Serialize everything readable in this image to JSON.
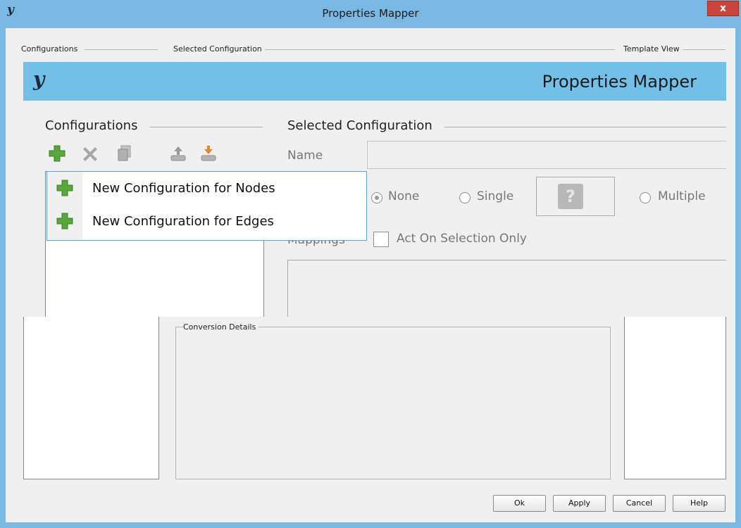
{
  "window": {
    "title": "Properties Mapper",
    "logo": "y",
    "close_label": "x"
  },
  "outer": {
    "configurations_label": "Configurations",
    "selected_configuration_label": "Selected Configuration",
    "template_view_label": "Template View",
    "conversion_details_label": "Conversion Details",
    "buttons": {
      "ok": "Ok",
      "apply": "Apply",
      "cancel": "Cancel",
      "help": "Help"
    }
  },
  "zoom": {
    "logo": "y",
    "title": "Properties Mapper",
    "configurations_label": "Configurations",
    "selected_configuration_label": "Selected Configuration",
    "name_label": "Name",
    "name_value": "",
    "radio_none": "None",
    "radio_single": "Single",
    "radio_multiple": "Multiple",
    "help_glyph": "?",
    "mappings_label": "Mappings",
    "act_on_selection_label": "Act On Selection Only",
    "toolbar_icons": [
      "add-icon",
      "delete-icon",
      "copy-icon",
      "export-icon",
      "import-icon"
    ],
    "menu": [
      {
        "icon": "add-icon",
        "label": "New Configuration for Nodes"
      },
      {
        "icon": "add-icon",
        "label": "New Configuration for Edges"
      }
    ]
  },
  "colors": {
    "titlebar": "#7ab8e4",
    "accent_plus": "#58a63c",
    "close": "#c9463d"
  }
}
